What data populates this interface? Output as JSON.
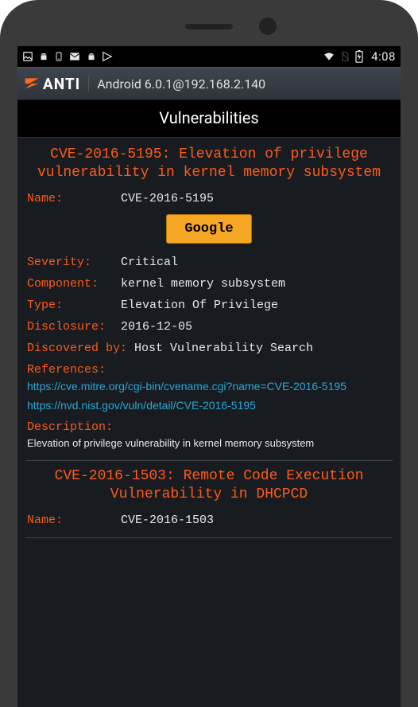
{
  "statusbar": {
    "clock": "4:08"
  },
  "appbar": {
    "brand": "ANTI",
    "subtitle": "Android 6.0.1@192.168.2.140"
  },
  "page": {
    "title": "Vulnerabilities"
  },
  "labels": {
    "name": "Name:",
    "severity": "Severity:",
    "component": "Component:",
    "type": "Type:",
    "disclosure": "Disclosure:",
    "discovered_by": "Discovered by:",
    "references": "References:",
    "description": "Description:"
  },
  "button": {
    "google": "Google"
  },
  "vulns": [
    {
      "title": "CVE-2016-5195: Elevation of privilege vulnerability in kernel memory subsystem",
      "name": "CVE-2016-5195",
      "severity": "Critical",
      "component": "kernel memory subsystem",
      "type": "Elevation Of Privilege",
      "disclosure": "2016-12-05",
      "discovered_by": "Host Vulnerability Search",
      "references": [
        "https://cve.mitre.org/cgi-bin/cvename.cgi?name=CVE-2016-5195",
        "https://nvd.nist.gov/vuln/detail/CVE-2016-5195"
      ],
      "description": "Elevation of privilege vulnerability in kernel memory subsystem"
    },
    {
      "title": "CVE-2016-1503: Remote Code Execution Vulnerability in DHCPCD",
      "name": "CVE-2016-1503"
    }
  ]
}
